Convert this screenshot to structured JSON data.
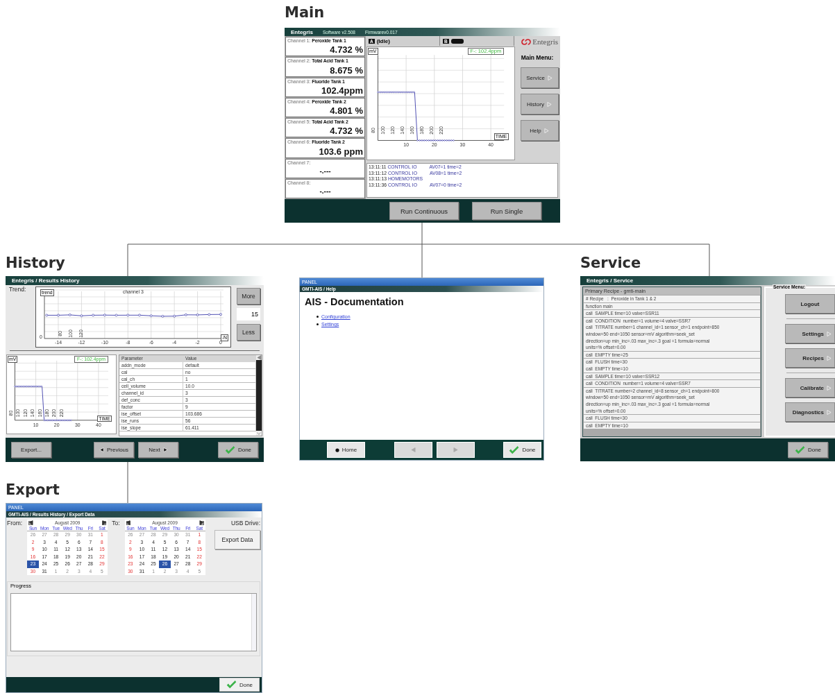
{
  "main": {
    "label": "Main",
    "title": "Entegris",
    "software": "Software v2.508",
    "firmware": "Firmwarev0.017",
    "channels": [
      {
        "label": "Channel 1:",
        "name": "Peroxide Tank 1",
        "value": "4.732 %"
      },
      {
        "label": "Channel 2:",
        "name": "Total Acid Tank 1",
        "value": "8.675 %"
      },
      {
        "label": "Channel 3:",
        "name": "Fluoride Tank 1",
        "value": "102.4ppm"
      },
      {
        "label": "Channel 4:",
        "name": "Peroxide Tank 2",
        "value": "4.801 %"
      },
      {
        "label": "Channel 5:",
        "name": "Total Acid Tank 2",
        "value": "4.732 %"
      },
      {
        "label": "Channel 6:",
        "name": "Fluoride Tank 2",
        "value": "103.6 ppm"
      },
      {
        "label": "Channel 7:",
        "value": "-.---"
      },
      {
        "label": "Channel 8:",
        "value": "-.---"
      }
    ],
    "tabs": [
      {
        "letter": "A",
        "status": "(Idle)"
      },
      {
        "letter": "B"
      }
    ],
    "logo": "Entegris",
    "chart": {
      "y_label": "mV",
      "readout": "F-: 102.4ppm",
      "y_tick_labels": [
        "80",
        "100",
        "120",
        "140",
        "160",
        "180",
        "200",
        "220"
      ],
      "x_tick_labels": [
        "10",
        "20",
        "30",
        "40"
      ],
      "x_label": "TIME"
    },
    "menu_title": "Main Menu:",
    "menu": [
      "Service",
      "History",
      "Help"
    ],
    "log": [
      {
        "time": "13:11:11",
        "source": "CONTROL IO",
        "detail": "AV07=1 time=2"
      },
      {
        "time": "13:11:12",
        "source": "CONTROL IO",
        "detail": "AV08=1 time=2"
      },
      {
        "time": "13:11:13",
        "source": "HOMEMOTORS"
      },
      {
        "time": "13:11:36",
        "source": "CONTROL IO",
        "detail": "AV07=0 time=2"
      }
    ],
    "buttons": [
      "Run Continuous",
      "Run Single"
    ]
  },
  "history": {
    "label": "History",
    "title": "Entegris / Results History",
    "trend_label": "Trend:",
    "trend": {
      "tag": "trend",
      "title": "channel 3",
      "y_tick_labels": [
        "0",
        "80",
        "100",
        "120"
      ],
      "x_tick_labels": [
        "-14",
        "-12",
        "-10",
        "-8",
        "-6",
        "-4",
        "-2",
        "0"
      ],
      "x_label": "-N"
    },
    "more": "More",
    "count": "15",
    "less": "Less",
    "chart": {
      "y_label": "mV",
      "readout": "F-: 102.4ppm",
      "y_tick_labels": [
        "80",
        "100",
        "120",
        "140",
        "160",
        "180",
        "200",
        "220"
      ],
      "x_tick_labels": [
        "10",
        "20",
        "30",
        "40"
      ],
      "x_label": "TIME"
    },
    "table": {
      "columns": [
        "Parameter",
        "Value"
      ],
      "rows": [
        [
          "addn_mode",
          "default"
        ],
        [
          "cal",
          "no"
        ],
        [
          "cal_ch",
          "1"
        ],
        [
          "cell_volume",
          "10.0"
        ],
        [
          "channel_id",
          "3"
        ],
        [
          "def_conc",
          "3"
        ],
        [
          "factor",
          "9"
        ],
        [
          "ise_offset",
          "103.686"
        ],
        [
          "ise_runs",
          "56"
        ],
        [
          "ise_slope",
          "61.411"
        ]
      ]
    },
    "buttons": [
      {
        "kind": "plain",
        "label": "Export..."
      },
      {
        "kind": "previous",
        "label": "Previous"
      },
      {
        "kind": "next",
        "label": "Next"
      },
      {
        "kind": "done",
        "label": "Done"
      }
    ]
  },
  "help": {
    "window_title": "PANEL",
    "breadcrumb": "GMTI-AIS / Help",
    "heading": "AIS - Documentation",
    "links": [
      "Configuration",
      "Settings"
    ],
    "buttons": [
      {
        "kind": "home",
        "label": "Home",
        "disabled": false
      },
      {
        "kind": "back",
        "disabled": true
      },
      {
        "kind": "forward",
        "disabled": true
      },
      {
        "kind": "done",
        "label": "Done",
        "disabled": false
      }
    ]
  },
  "service": {
    "label": "Service",
    "title": "Entegris / Service",
    "recipe_title": "Primary Recipe - gmti-main",
    "rows": [
      [
        "# Recipe   :  Peroxide in Tank 1 & 2"
      ],
      [
        "function main"
      ],
      [
        "call  SAMPLE time=10 valve=SSR11"
      ],
      [
        "call  CONDITION  number=1 volume=4 valve=SSR7",
        "call  TITRATE number=1 channel_id=1 sensor_ch=1 endpoint=850",
        "window=50 end=1050 sensor=mV algorithm=seek_set",
        "direction=up min_inc=.03 max_inc=.3 goal =1 formula=normal",
        "units=% offset=0.00"
      ],
      [
        "call  EMPTY time=25"
      ],
      [
        "call  FLUSH time=30",
        "call  EMPTY time=10"
      ],
      [
        "call  SAMPLE time=10 valve=SSR12"
      ],
      [
        "call  CONDITION  number=1 volume=4 valve=SSR7"
      ],
      [
        "call  TITRATE number=2 channel_id=8 sensor_ch=1 endpoint=800",
        "window=50 end=1050 sensor=mV algorithm=seek_set",
        "direction=up min_inc=.03 max_inc=.3 goal =1 formula=normal",
        "units=% offset=0.00"
      ],
      [
        "call  FLUSH time=30"
      ],
      [
        "call  EMPTY time=10"
      ]
    ],
    "menu_title": "Service Menu:",
    "menu": [
      {
        "label": "Logout",
        "arrow": false
      },
      {
        "label": "Settings",
        "arrow": true
      },
      {
        "label": "Recipes",
        "arrow": true
      },
      {
        "label": "Calibrate",
        "arrow": true
      },
      {
        "label": "Diagnostics",
        "arrow": true
      }
    ],
    "done": "Done"
  },
  "export": {
    "label": "Export",
    "window_title": "PANEL",
    "breadcrumb": "GMTI-AIS / Results History / Export Data",
    "calendars": [
      {
        "label": "From:",
        "month": "August 2009",
        "weekdays": [
          "Sun",
          "Mon",
          "Tue",
          "Wed",
          "Thu",
          "Fri",
          "Sat"
        ],
        "days": [
          {
            "day": "26",
            "other_month": true,
            "selected": false
          },
          {
            "day": "27",
            "other_month": true,
            "selected": false
          },
          {
            "day": "28",
            "other_month": true,
            "selected": false
          },
          {
            "day": "29",
            "other_month": true,
            "selected": false
          },
          {
            "day": "30",
            "other_month": true,
            "selected": false
          },
          {
            "day": "31",
            "other_month": true,
            "selected": false
          },
          {
            "day": "1",
            "other_month": false,
            "selected": false
          },
          {
            "day": "2",
            "other_month": false,
            "selected": false
          },
          {
            "day": "3",
            "other_month": false,
            "selected": false
          },
          {
            "day": "4",
            "other_month": false,
            "selected": false
          },
          {
            "day": "5",
            "other_month": false,
            "selected": false
          },
          {
            "day": "6",
            "other_month": false,
            "selected": false
          },
          {
            "day": "7",
            "other_month": false,
            "selected": false
          },
          {
            "day": "8",
            "other_month": false,
            "selected": false
          },
          {
            "day": "9",
            "other_month": false,
            "selected": false
          },
          {
            "day": "10",
            "other_month": false,
            "selected": false
          },
          {
            "day": "11",
            "other_month": false,
            "selected": false
          },
          {
            "day": "12",
            "other_month": false,
            "selected": false
          },
          {
            "day": "13",
            "other_month": false,
            "selected": false
          },
          {
            "day": "14",
            "other_month": false,
            "selected": false
          },
          {
            "day": "15",
            "other_month": false,
            "selected": false
          },
          {
            "day": "16",
            "other_month": false,
            "selected": false
          },
          {
            "day": "17",
            "other_month": false,
            "selected": false
          },
          {
            "day": "18",
            "other_month": false,
            "selected": false
          },
          {
            "day": "19",
            "other_month": false,
            "selected": false
          },
          {
            "day": "20",
            "other_month": false,
            "selected": false
          },
          {
            "day": "21",
            "other_month": false,
            "selected": false
          },
          {
            "day": "22",
            "other_month": false,
            "selected": false
          },
          {
            "day": "23",
            "other_month": false,
            "selected": true
          },
          {
            "day": "24",
            "other_month": false,
            "selected": false
          },
          {
            "day": "25",
            "other_month": false,
            "selected": false
          },
          {
            "day": "26",
            "other_month": false,
            "selected": false
          },
          {
            "day": "27",
            "other_month": false,
            "selected": false
          },
          {
            "day": "28",
            "other_month": false,
            "selected": false
          },
          {
            "day": "29",
            "other_month": false,
            "selected": false
          },
          {
            "day": "30",
            "other_month": false,
            "selected": false
          },
          {
            "day": "31",
            "other_month": false,
            "selected": false
          },
          {
            "day": "1",
            "other_month": true,
            "selected": false
          },
          {
            "day": "2",
            "other_month": true,
            "selected": false
          },
          {
            "day": "3",
            "other_month": true,
            "selected": false
          },
          {
            "day": "4",
            "other_month": true,
            "selected": false
          },
          {
            "day": "5",
            "other_month": true,
            "selected": false
          }
        ]
      },
      {
        "label": "To:",
        "month": "August 2009",
        "weekdays": [
          "Sun",
          "Mon",
          "Tue",
          "Wed",
          "Thu",
          "Fri",
          "Sat"
        ],
        "days": [
          {
            "day": "26",
            "other_month": true,
            "selected": false
          },
          {
            "day": "27",
            "other_month": true,
            "selected": false
          },
          {
            "day": "28",
            "other_month": true,
            "selected": false
          },
          {
            "day": "29",
            "other_month": true,
            "selected": false
          },
          {
            "day": "30",
            "other_month": true,
            "selected": false
          },
          {
            "day": "31",
            "other_month": true,
            "selected": false
          },
          {
            "day": "1",
            "other_month": false,
            "selected": false
          },
          {
            "day": "2",
            "other_month": false,
            "selected": false
          },
          {
            "day": "3",
            "other_month": false,
            "selected": false
          },
          {
            "day": "4",
            "other_month": false,
            "selected": false
          },
          {
            "day": "5",
            "other_month": false,
            "selected": false
          },
          {
            "day": "6",
            "other_month": false,
            "selected": false
          },
          {
            "day": "7",
            "other_month": false,
            "selected": false
          },
          {
            "day": "8",
            "other_month": false,
            "selected": false
          },
          {
            "day": "9",
            "other_month": false,
            "selected": false
          },
          {
            "day": "10",
            "other_month": false,
            "selected": false
          },
          {
            "day": "11",
            "other_month": false,
            "selected": false
          },
          {
            "day": "12",
            "other_month": false,
            "selected": false
          },
          {
            "day": "13",
            "other_month": false,
            "selected": false
          },
          {
            "day": "14",
            "other_month": false,
            "selected": false
          },
          {
            "day": "15",
            "other_month": false,
            "selected": false
          },
          {
            "day": "16",
            "other_month": false,
            "selected": false
          },
          {
            "day": "17",
            "other_month": false,
            "selected": false
          },
          {
            "day": "18",
            "other_month": false,
            "selected": false
          },
          {
            "day": "19",
            "other_month": false,
            "selected": false
          },
          {
            "day": "20",
            "other_month": false,
            "selected": false
          },
          {
            "day": "21",
            "other_month": false,
            "selected": false
          },
          {
            "day": "22",
            "other_month": false,
            "selected": false
          },
          {
            "day": "23",
            "other_month": false,
            "selected": false
          },
          {
            "day": "24",
            "other_month": false,
            "selected": false
          },
          {
            "day": "25",
            "other_month": false,
            "selected": false
          },
          {
            "day": "26",
            "other_month": false,
            "selected": true
          },
          {
            "day": "27",
            "other_month": false,
            "selected": false
          },
          {
            "day": "28",
            "other_month": false,
            "selected": false
          },
          {
            "day": "29",
            "other_month": false,
            "selected": false
          },
          {
            "day": "30",
            "other_month": false,
            "selected": false
          },
          {
            "day": "31",
            "other_month": false,
            "selected": false
          },
          {
            "day": "1",
            "other_month": true,
            "selected": false
          },
          {
            "day": "2",
            "other_month": true,
            "selected": false
          },
          {
            "day": "3",
            "other_month": true,
            "selected": false
          },
          {
            "day": "4",
            "other_month": true,
            "selected": false
          },
          {
            "day": "5",
            "other_month": true,
            "selected": false
          }
        ]
      }
    ],
    "usb_label": "USB Drive:",
    "export_button": "Export Data",
    "progress_label": "Progress",
    "done": "Done"
  }
}
